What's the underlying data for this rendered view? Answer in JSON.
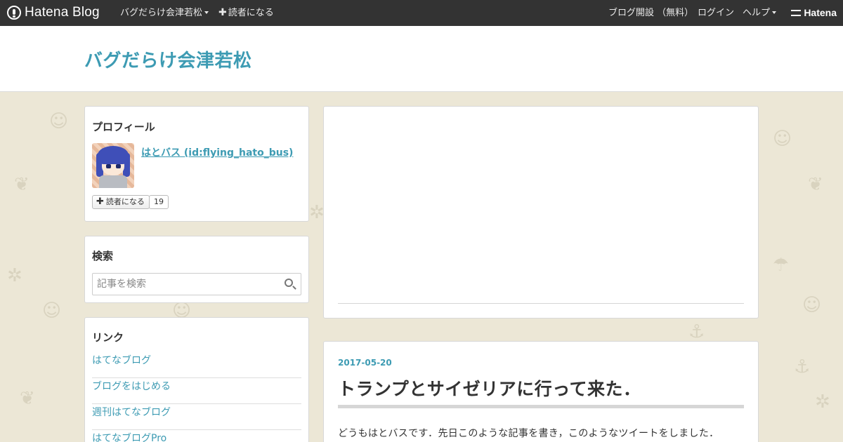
{
  "topbar": {
    "logo_text": "Hatena Blog",
    "blog_menu_label": "バグだらけ会津若松",
    "subscribe_label": "読者になる",
    "open_blog_label": "ブログ開設 （無料）",
    "login_label": "ログイン",
    "help_label": "ヘルプ",
    "hatena_label": "Hatena"
  },
  "header": {
    "blog_title": "バグだらけ会津若松"
  },
  "sidebar": {
    "profile": {
      "title": "プロフィール",
      "name": "はとバス (id:flying_hato_bus)",
      "follow_label": "読者になる",
      "follower_count": "19"
    },
    "search": {
      "title": "検索",
      "placeholder": "記事を検索"
    },
    "links": {
      "title": "リンク",
      "items": [
        {
          "label": "はてなブログ"
        },
        {
          "label": "ブログをはじめる"
        },
        {
          "label": "週刊はてなブログ"
        },
        {
          "label": "はてなブログPro"
        }
      ]
    }
  },
  "post": {
    "date": "2017-05-20",
    "title": "トランプとサイゼリアに行って来た．",
    "body_first_line": "どうもはとバスです．先日このような記事を書き，このようなツイートをしました．"
  },
  "colors": {
    "topbar_bg": "#333333",
    "accent": "#3d9bb3",
    "page_bg": "#ece7d6",
    "text": "#333333"
  }
}
